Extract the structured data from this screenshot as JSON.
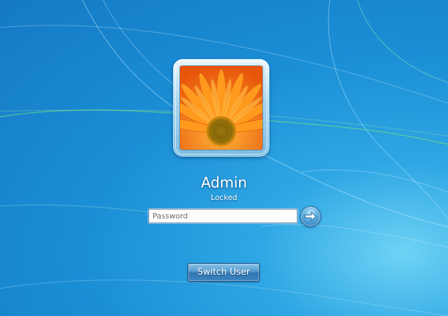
{
  "screen": {
    "background_color": "#1b8fd6",
    "accent_color": "#4e95c8"
  },
  "user": {
    "name": "Admin",
    "status": "Locked",
    "avatar_icon": "orange-gerbera-flower"
  },
  "password": {
    "placeholder": "Password",
    "value": ""
  },
  "submit": {
    "icon": "arrow-right-icon"
  },
  "switch_user": {
    "label": "Switch User"
  }
}
